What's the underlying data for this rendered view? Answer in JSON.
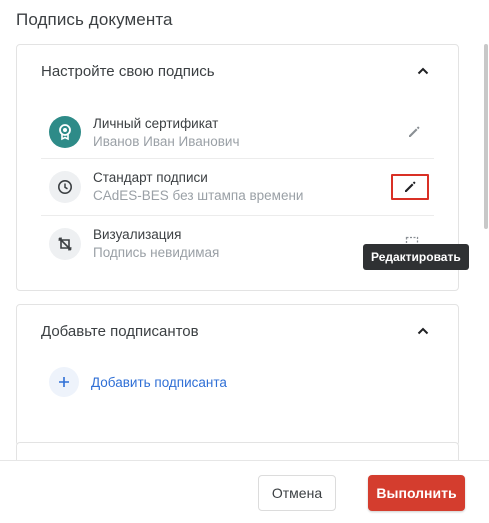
{
  "page": {
    "title": "Подпись документа"
  },
  "signature_card": {
    "title": "Настройте свою подпись",
    "items": [
      {
        "label": "Личный сертификат",
        "value": "Иванов Иван Иванович",
        "icon": "certificate-icon",
        "action_icon": "pencil-icon"
      },
      {
        "label": "Стандарт подписи",
        "value": "CAdES-BES без штампа времени",
        "icon": "clock-icon",
        "action_icon": "pencil-icon"
      },
      {
        "label": "Визуализация",
        "value": "Подпись невидимая",
        "icon": "crop-off-icon",
        "action_icon": "cursor-select-icon"
      }
    ],
    "tooltip": "Редактировать"
  },
  "signers_card": {
    "title": "Добавьте подписантов",
    "add_label": "Добавить подписанта"
  },
  "footer": {
    "cancel_label": "Отмена",
    "submit_label": "Выполнить"
  },
  "colors": {
    "accent": "#d43d2e",
    "link": "#2f6fd6",
    "teal": "#2e8b88",
    "highlight_border": "#d93025"
  }
}
